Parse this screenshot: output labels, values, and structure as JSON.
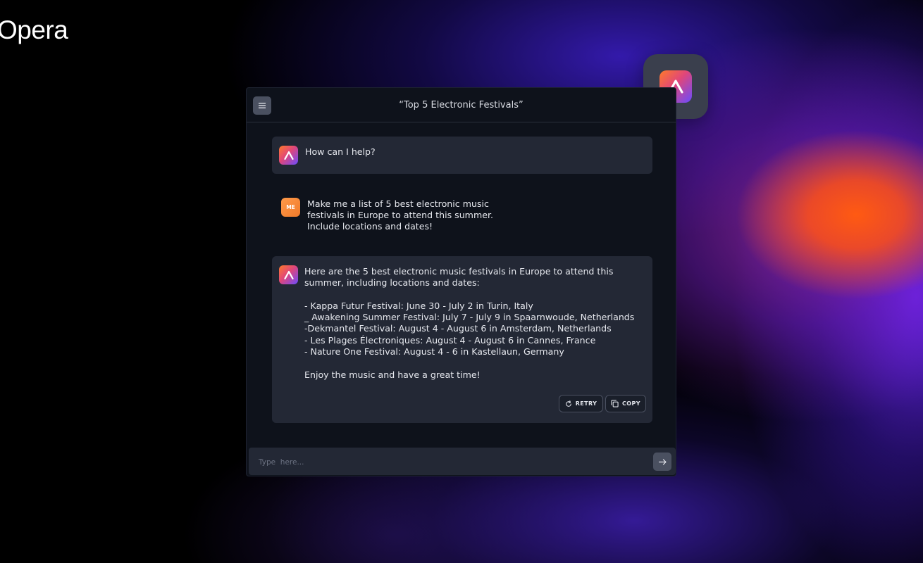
{
  "brand": {
    "logo_text": "Opera"
  },
  "colors": {
    "accent_orange": "#ff5a12",
    "accent_violet": "#6a4bff",
    "panel_bg": "#0e121b",
    "bubble_bg": "#232835"
  },
  "header": {
    "title": "“Top 5 Electronic Festivals”",
    "menu_icon": "menu-icon"
  },
  "messages": {
    "greeting": {
      "text": "How can I help?"
    },
    "user": {
      "avatar_label": "ME",
      "text": "Make me a list of 5 best electronic music festivals in Europe to attend this summer. Include locations and dates!"
    },
    "response": {
      "intro": "Here are the 5 best electronic music festivals in Europe to attend this summer, including locations and dates:",
      "items": [
        "- Kappa Futur Festival: June 30 - July 2 in Turin, Italy",
        "_ Awakening Summer Festival: July 7 - July 9 in Spaarnwoude, Netherlands",
        "-Dekmantel Festival: August 4 - August 6 in Amsterdam, Netherlands",
        "- Les Plages Électroniques: August 4 - August 6 in Cannes, France",
        "- Nature One Festival: August 4 - 6 in Kastellaun, Germany"
      ],
      "outro": "Enjoy the music and have a great time!",
      "retry_label": "RETRY",
      "copy_label": "COPY"
    }
  },
  "composer": {
    "placeholder": "Type  here...",
    "value": "",
    "send_icon": "arrow-right-icon"
  }
}
